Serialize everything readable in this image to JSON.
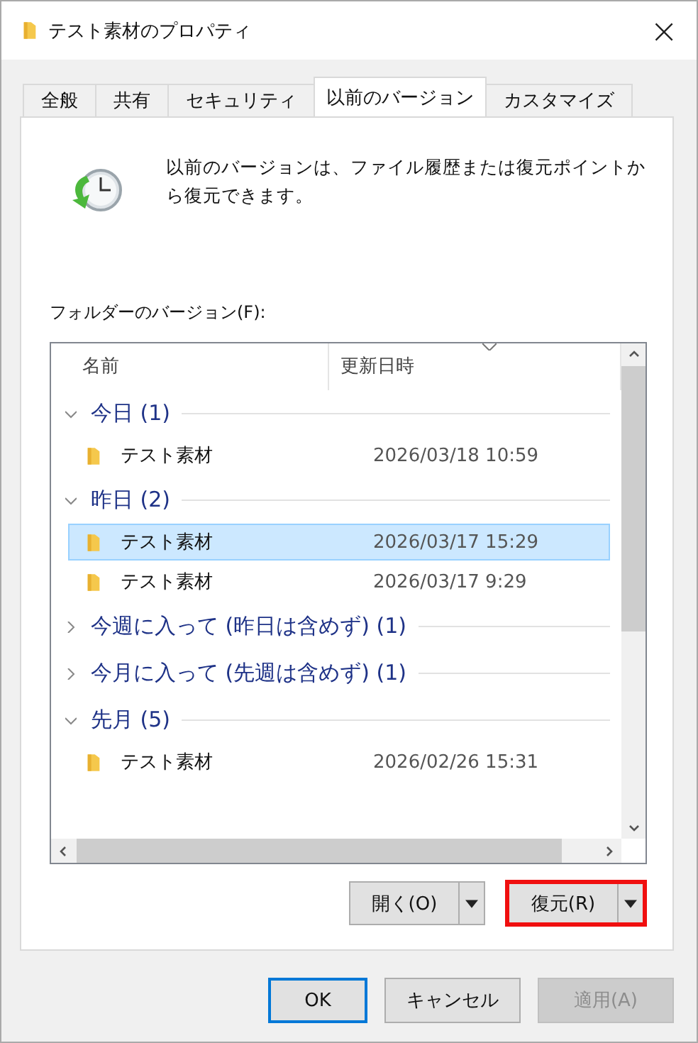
{
  "window": {
    "title": "テスト素材のプロパティ",
    "close": "×"
  },
  "tabs": [
    {
      "label": "全般",
      "selected": false
    },
    {
      "label": "共有",
      "selected": false
    },
    {
      "label": "セキュリティ",
      "selected": false
    },
    {
      "label": "以前のバージョン",
      "selected": true
    },
    {
      "label": "カスタマイズ",
      "selected": false
    }
  ],
  "description": "以前のバージョンは、ファイル履歴または復元ポイントから復元できます。",
  "list_label": "フォルダーのバージョン(F):",
  "columns": [
    "名前",
    "更新日時"
  ],
  "groups": [
    {
      "label": "今日 (1)",
      "expanded": true,
      "items": [
        {
          "name": "テスト素材",
          "modified": "2026/03/18 10:59",
          "selected": false
        }
      ]
    },
    {
      "label": "昨日 (2)",
      "expanded": true,
      "items": [
        {
          "name": "テスト素材",
          "modified": "2026/03/17 15:29",
          "selected": true
        },
        {
          "name": "テスト素材",
          "modified": "2026/03/17 9:29",
          "selected": false
        }
      ]
    },
    {
      "label": "今週に入って (昨日は含めず) (1)",
      "expanded": false
    },
    {
      "label": "今月に入って (先週は含めず) (1)",
      "expanded": false
    },
    {
      "label": "先月 (5)",
      "expanded": true,
      "items": [
        {
          "name": "テスト素材",
          "modified": "2026/02/26 15:31",
          "selected": false
        }
      ]
    }
  ],
  "action_buttons": [
    {
      "label": "開く(O)",
      "highlighted": false
    },
    {
      "label": "復元(R)",
      "highlighted": true
    }
  ],
  "dialog_buttons": [
    {
      "label": "OK",
      "default": true,
      "disabled": false
    },
    {
      "label": "キャンセル",
      "default": false,
      "disabled": false
    },
    {
      "label": "適用(A)",
      "default": false,
      "disabled": true
    }
  ]
}
